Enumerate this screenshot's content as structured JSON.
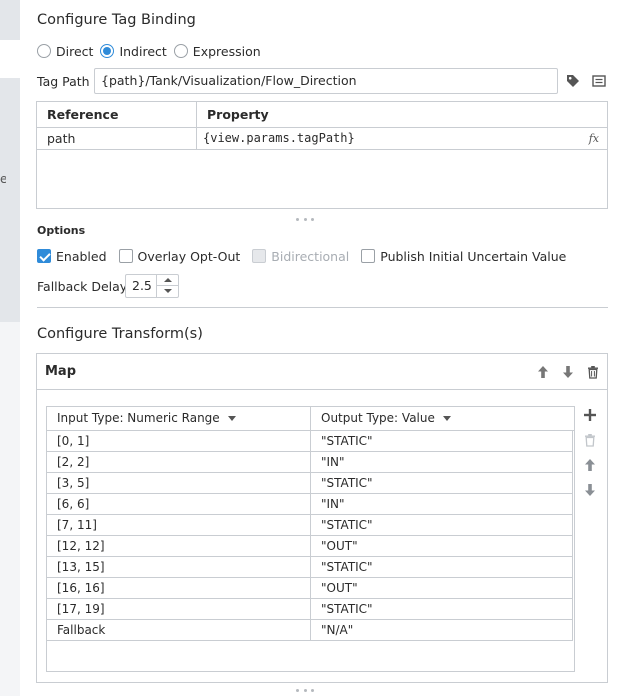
{
  "title": "Configure Tag Binding",
  "binding_types": [
    {
      "label": "Direct",
      "selected": false
    },
    {
      "label": "Indirect",
      "selected": true
    },
    {
      "label": "Expression",
      "selected": false
    }
  ],
  "tag_path": {
    "label": "Tag Path",
    "value": "{path}/Tank/Visualization/Flow_Direction"
  },
  "references": {
    "headers": {
      "reference": "Reference",
      "property": "Property"
    },
    "rows": [
      {
        "reference": "path",
        "property": "{view.params.tagPath}",
        "fx": "fx"
      }
    ]
  },
  "options": {
    "label": "Options",
    "checkboxes": [
      {
        "label": "Enabled",
        "checked": true,
        "disabled": false
      },
      {
        "label": "Overlay Opt-Out",
        "checked": false,
        "disabled": false
      },
      {
        "label": "Bidirectional",
        "checked": false,
        "disabled": true
      },
      {
        "label": "Publish Initial Uncertain Value",
        "checked": false,
        "disabled": false
      }
    ],
    "fallback_delay": {
      "label": "Fallback Delay",
      "value": "2.5"
    }
  },
  "transforms": {
    "title": "Configure Transform(s)",
    "map": {
      "title": "Map",
      "input_type_label": "Input Type: Numeric Range",
      "output_type_label": "Output Type: Value",
      "rows": [
        {
          "input": "[0, 1]",
          "output": "\"STATIC\""
        },
        {
          "input": "[2, 2]",
          "output": "\"IN\""
        },
        {
          "input": "[3, 5]",
          "output": "\"STATIC\""
        },
        {
          "input": "[6, 6]",
          "output": "\"IN\""
        },
        {
          "input": "[7, 11]",
          "output": "\"STATIC\""
        },
        {
          "input": "[12, 12]",
          "output": "\"OUT\""
        },
        {
          "input": "[13, 15]",
          "output": "\"STATIC\""
        },
        {
          "input": "[16, 16]",
          "output": "\"OUT\""
        },
        {
          "input": "[17, 19]",
          "output": "\"STATIC\""
        },
        {
          "input": "Fallback",
          "output": "\"N/A\""
        }
      ]
    }
  },
  "colors": {
    "accent": "#2f8bd9",
    "border": "#c9cdd2",
    "icon": "#555555",
    "disabled_text": "#a8adb3"
  },
  "icons": [
    "tag-icon",
    "browse-icon",
    "move-up-icon",
    "move-down-icon",
    "trash-icon",
    "plus-icon",
    "grip-icon"
  ]
}
